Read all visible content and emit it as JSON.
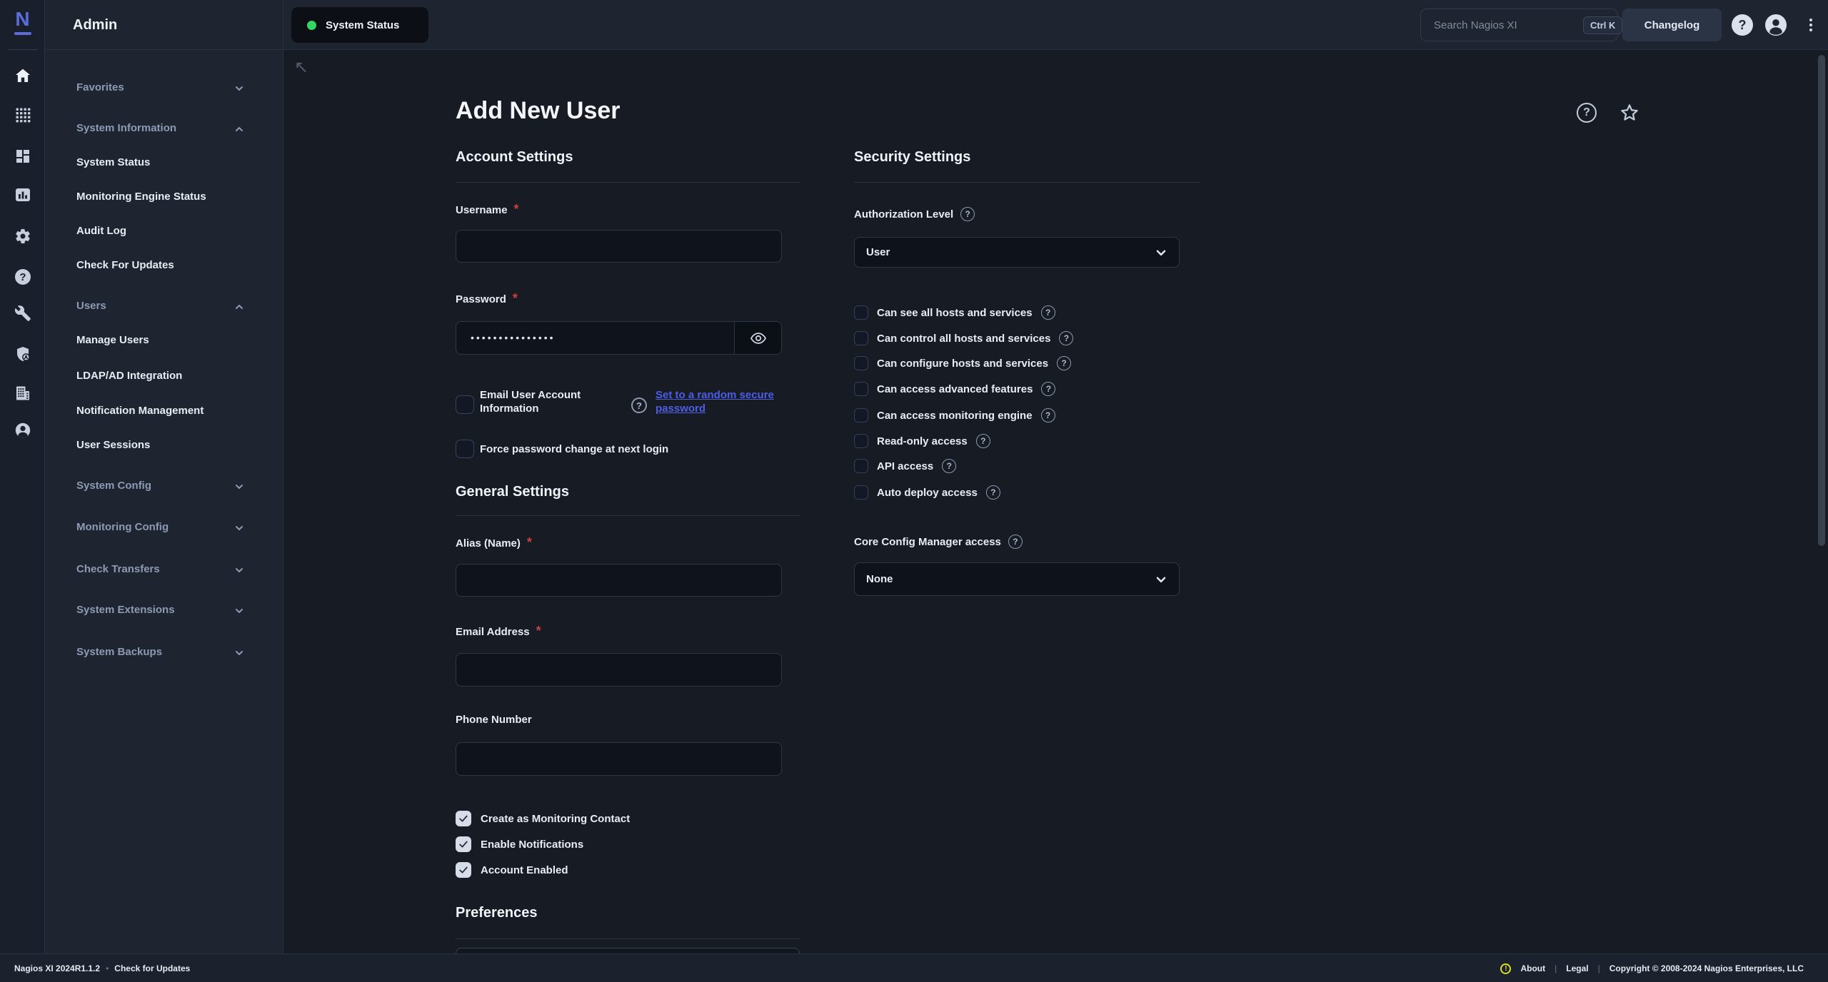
{
  "brand": {
    "letter": "N"
  },
  "topbar": {
    "app_title": "Admin",
    "tab_label": "System Status",
    "search_placeholder": "Search Nagios XI",
    "search_shortcut": "Ctrl K",
    "changelog_label": "Changelog"
  },
  "sidebar": {
    "items": [
      {
        "label": "Favorites"
      },
      {
        "label": "System Information"
      },
      {
        "label": "System Status"
      },
      {
        "label": "Monitoring Engine Status"
      },
      {
        "label": "Audit Log"
      },
      {
        "label": "Check For Updates"
      },
      {
        "label": "Users"
      },
      {
        "label": "Manage Users"
      },
      {
        "label": "LDAP/AD Integration"
      },
      {
        "label": "Notification Management"
      },
      {
        "label": "User Sessions"
      },
      {
        "label": "System Config"
      },
      {
        "label": "Monitoring Config"
      },
      {
        "label": "Check Transfers"
      },
      {
        "label": "System Extensions"
      },
      {
        "label": "System Backups"
      }
    ]
  },
  "page": {
    "title": "Add New User",
    "account": {
      "heading": "Account Settings",
      "username_label": "Username",
      "password_label": "Password",
      "password_value": "•••••••••••••••",
      "email_info_label": "Email User Account Information",
      "random_password_link": "Set to a random secure password",
      "force_change_label": "Force password change at next login"
    },
    "general": {
      "heading": "General Settings",
      "alias_label": "Alias (Name)",
      "email_label": "Email Address",
      "phone_label": "Phone Number",
      "checkboxes": [
        "Create as Monitoring Contact",
        "Enable Notifications",
        "Account Enabled"
      ]
    },
    "preferences_heading": "Preferences",
    "security": {
      "heading": "Security Settings",
      "auth_label": "Authorization Level",
      "auth_value": "User",
      "perms": [
        "Can see all hosts and services",
        "Can control all hosts and services",
        "Can configure hosts and services",
        "Can access advanced features",
        "Can access monitoring engine",
        "Read-only access",
        "API access",
        "Auto deploy access"
      ],
      "ccm_label": "Core Config Manager access",
      "ccm_value": "None"
    }
  },
  "footer": {
    "version": "Nagios XI 2024R1.1.2",
    "dot": "•",
    "check_updates": "Check for Updates",
    "about": "About",
    "sep": "|",
    "legal": "Legal",
    "copyright": "Copyright © 2008-2024 Nagios Enterprises, LLC",
    "alert_glyph": "!"
  },
  "misc": {
    "required": "*",
    "help": "?"
  },
  "colors": {
    "brand_blue": "#5b6cdd",
    "link_blue": "#4d5ee4",
    "status_green": "#33d863",
    "required_red": "#c94040",
    "footer_yellow": "#d9e026"
  }
}
